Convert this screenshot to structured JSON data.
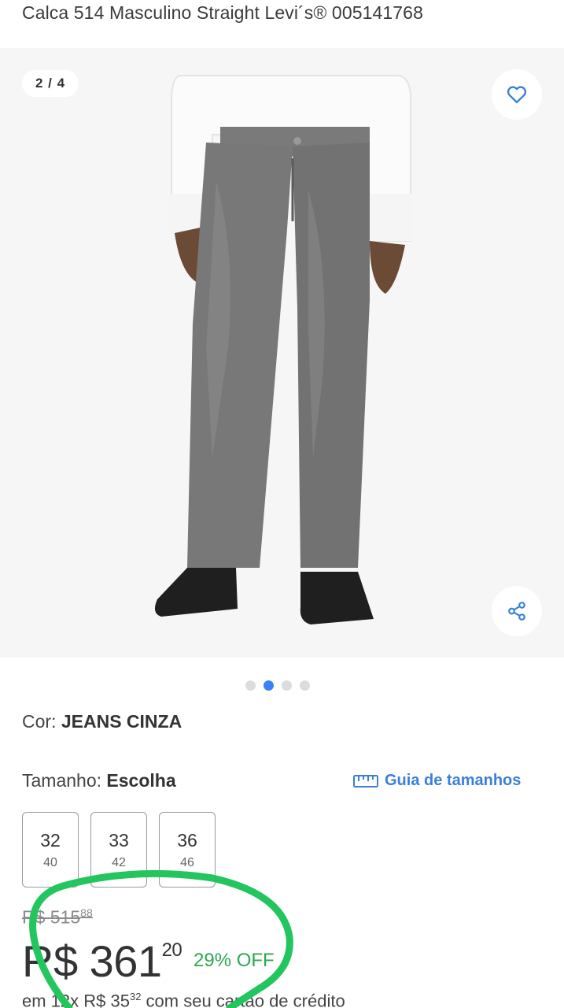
{
  "product": {
    "title": "Calca 514 Masculino Straight Levi´s® 005141768"
  },
  "gallery": {
    "counter": "2 / 4",
    "favorite_icon": "heart-icon",
    "share_icon": "share-icon",
    "image_name": "product-photo-gray-jeans",
    "active_index": 1,
    "total": 4
  },
  "color": {
    "label": "Cor:",
    "value": "JEANS CINZA"
  },
  "size": {
    "label": "Tamanho:",
    "value": "Escolha",
    "guide_label": "Guia de tamanhos",
    "guide_icon": "ruler-icon",
    "options": [
      {
        "size": "32",
        "equiv": "40"
      },
      {
        "size": "33",
        "equiv": "42"
      },
      {
        "size": "36",
        "equiv": "46"
      }
    ]
  },
  "pricing": {
    "old_price_main": "R$ 515",
    "old_price_cents": "88",
    "price_main": "R$ 361",
    "price_cents": "20",
    "discount": "29% OFF",
    "installments_prefix": "em 12x R$ 35",
    "installments_cents": "32",
    "installments_suffix": " com seu cartão de crédito"
  },
  "colors": {
    "accent": "#3b82f6",
    "link": "#3b7fd9",
    "discount": "#2ca84e",
    "annotation": "#22c55e"
  }
}
